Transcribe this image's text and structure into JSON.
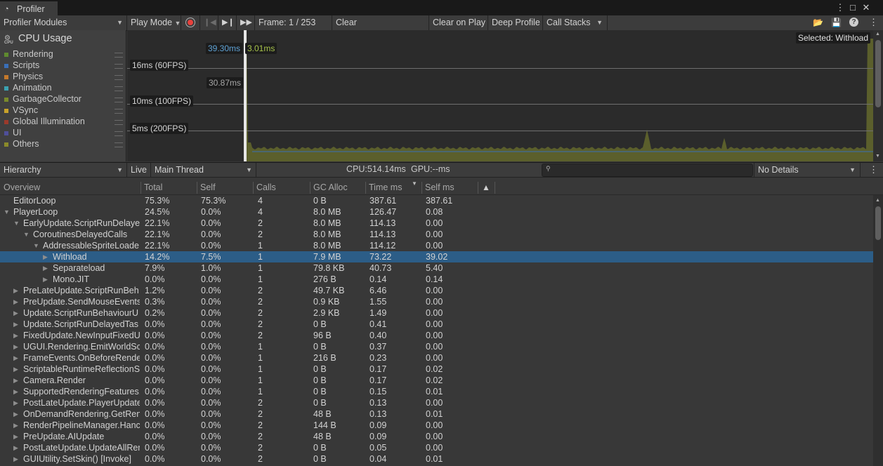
{
  "window": {
    "tab_title": "Profiler",
    "tab_icon": "profiler-icon",
    "menu_icons": [
      "more-vertical-icon",
      "maximize-icon",
      "close-icon"
    ]
  },
  "toolbar": {
    "modules_label": "Profiler Modules",
    "play_mode_label": "Play Mode",
    "frame_label": "Frame: 1 / 253",
    "clear_label": "Clear",
    "clear_on_play_label": "Clear on Play",
    "deep_profile_label": "Deep Profile",
    "call_stacks_label": "Call Stacks"
  },
  "module": {
    "title": "CPU Usage",
    "icon_label": "CPU",
    "legend": [
      {
        "label": "Rendering",
        "color": "#5f8a2f"
      },
      {
        "label": "Scripts",
        "color": "#3a6fb7"
      },
      {
        "label": "Physics",
        "color": "#c4792c"
      },
      {
        "label": "Animation",
        "color": "#3ba2b1"
      },
      {
        "label": "GarbageCollector",
        "color": "#7a8a2b"
      },
      {
        "label": "VSync",
        "color": "#c8a22a"
      },
      {
        "label": "Global Illumination",
        "color": "#9b3a2b"
      },
      {
        "label": "UI",
        "color": "#4f4f9a"
      },
      {
        "label": "Others",
        "color": "#8a8a2a"
      }
    ]
  },
  "chart": {
    "grid_labels": [
      "16ms (60FPS)",
      "10ms (100FPS)",
      "5ms (200FPS)"
    ],
    "tooltip_total": "39.30ms",
    "tooltip_selected": "3.01ms",
    "tooltip_second": "30.87ms",
    "selected_label": "Selected: Withload",
    "fill_color": "#5b5f2c"
  },
  "hierarchy_bar": {
    "view_label": "Hierarchy",
    "live_label": "Live",
    "thread_label": "Main Thread",
    "cpu_label": "CPU:514.14ms",
    "gpu_label": "GPU:--ms",
    "search_placeholder": "",
    "details_label": "No Details"
  },
  "table": {
    "headers": [
      "Overview",
      "Total",
      "Self",
      "Calls",
      "GC Alloc",
      "Time ms",
      "Self ms"
    ],
    "rows": [
      {
        "name": "EditorLoop",
        "total": "75.3%",
        "self": "75.3%",
        "calls": "4",
        "gc": "0 B",
        "time": "387.61",
        "selfms": "387.61"
      },
      {
        "name": "PlayerLoop",
        "total": "24.5%",
        "self": "0.0%",
        "calls": "4",
        "gc": "8.0 MB",
        "time": "126.47",
        "selfms": "0.08"
      },
      {
        "name": "EarlyUpdate.ScriptRunDelaye",
        "total": "22.1%",
        "self": "0.0%",
        "calls": "2",
        "gc": "8.0 MB",
        "time": "114.13",
        "selfms": "0.00"
      },
      {
        "name": "CoroutinesDelayedCalls",
        "total": "22.1%",
        "self": "0.0%",
        "calls": "2",
        "gc": "8.0 MB",
        "time": "114.13",
        "selfms": "0.00"
      },
      {
        "name": "AddressableSpriteLoade",
        "total": "22.1%",
        "self": "0.0%",
        "calls": "1",
        "gc": "8.0 MB",
        "time": "114.12",
        "selfms": "0.00"
      },
      {
        "name": "Withload",
        "total": "14.2%",
        "self": "7.5%",
        "calls": "1",
        "gc": "7.9 MB",
        "time": "73.22",
        "selfms": "39.02"
      },
      {
        "name": "Separateload",
        "total": "7.9%",
        "self": "1.0%",
        "calls": "1",
        "gc": "79.8 KB",
        "time": "40.73",
        "selfms": "5.40"
      },
      {
        "name": "Mono.JIT",
        "total": "0.0%",
        "self": "0.0%",
        "calls": "1",
        "gc": "276 B",
        "time": "0.14",
        "selfms": "0.14"
      },
      {
        "name": "PreLateUpdate.ScriptRunBeh",
        "total": "1.2%",
        "self": "0.0%",
        "calls": "2",
        "gc": "49.7 KB",
        "time": "6.46",
        "selfms": "0.00"
      },
      {
        "name": "PreUpdate.SendMouseEvents",
        "total": "0.3%",
        "self": "0.0%",
        "calls": "2",
        "gc": "0.9 KB",
        "time": "1.55",
        "selfms": "0.00"
      },
      {
        "name": "Update.ScriptRunBehaviourU",
        "total": "0.2%",
        "self": "0.0%",
        "calls": "2",
        "gc": "2.9 KB",
        "time": "1.49",
        "selfms": "0.00"
      },
      {
        "name": "Update.ScriptRunDelayedTas",
        "total": "0.0%",
        "self": "0.0%",
        "calls": "2",
        "gc": "0 B",
        "time": "0.41",
        "selfms": "0.00"
      },
      {
        "name": "FixedUpdate.NewInputFixedU",
        "total": "0.0%",
        "self": "0.0%",
        "calls": "2",
        "gc": "96 B",
        "time": "0.40",
        "selfms": "0.00"
      },
      {
        "name": "UGUI.Rendering.EmitWorldScr",
        "total": "0.0%",
        "self": "0.0%",
        "calls": "1",
        "gc": "0 B",
        "time": "0.37",
        "selfms": "0.00"
      },
      {
        "name": "FrameEvents.OnBeforeRende",
        "total": "0.0%",
        "self": "0.0%",
        "calls": "1",
        "gc": "216 B",
        "time": "0.23",
        "selfms": "0.00"
      },
      {
        "name": "ScriptableRuntimeReflectionS",
        "total": "0.0%",
        "self": "0.0%",
        "calls": "1",
        "gc": "0 B",
        "time": "0.17",
        "selfms": "0.02"
      },
      {
        "name": "Camera.Render",
        "total": "0.0%",
        "self": "0.0%",
        "calls": "1",
        "gc": "0 B",
        "time": "0.17",
        "selfms": "0.02"
      },
      {
        "name": "SupportedRenderingFeatures.",
        "total": "0.0%",
        "self": "0.0%",
        "calls": "1",
        "gc": "0 B",
        "time": "0.15",
        "selfms": "0.01"
      },
      {
        "name": "PostLateUpdate.PlayerUpdate",
        "total": "0.0%",
        "self": "0.0%",
        "calls": "2",
        "gc": "0 B",
        "time": "0.13",
        "selfms": "0.00"
      },
      {
        "name": "OnDemandRendering.GetRen",
        "total": "0.0%",
        "self": "0.0%",
        "calls": "2",
        "gc": "48 B",
        "time": "0.13",
        "selfms": "0.01"
      },
      {
        "name": "RenderPipelineManager.Hanc",
        "total": "0.0%",
        "self": "0.0%",
        "calls": "2",
        "gc": "144 B",
        "time": "0.09",
        "selfms": "0.00"
      },
      {
        "name": "PreUpdate.AIUpdate",
        "total": "0.0%",
        "self": "0.0%",
        "calls": "2",
        "gc": "48 B",
        "time": "0.09",
        "selfms": "0.00"
      },
      {
        "name": "PostLateUpdate.UpdateAllRer",
        "total": "0.0%",
        "self": "0.0%",
        "calls": "2",
        "gc": "0 B",
        "time": "0.05",
        "selfms": "0.00"
      },
      {
        "name": "GUIUtility.SetSkin() [Invoke]",
        "total": "0.0%",
        "self": "0.0%",
        "calls": "2",
        "gc": "0 B",
        "time": "0.04",
        "selfms": "0.01"
      }
    ]
  }
}
